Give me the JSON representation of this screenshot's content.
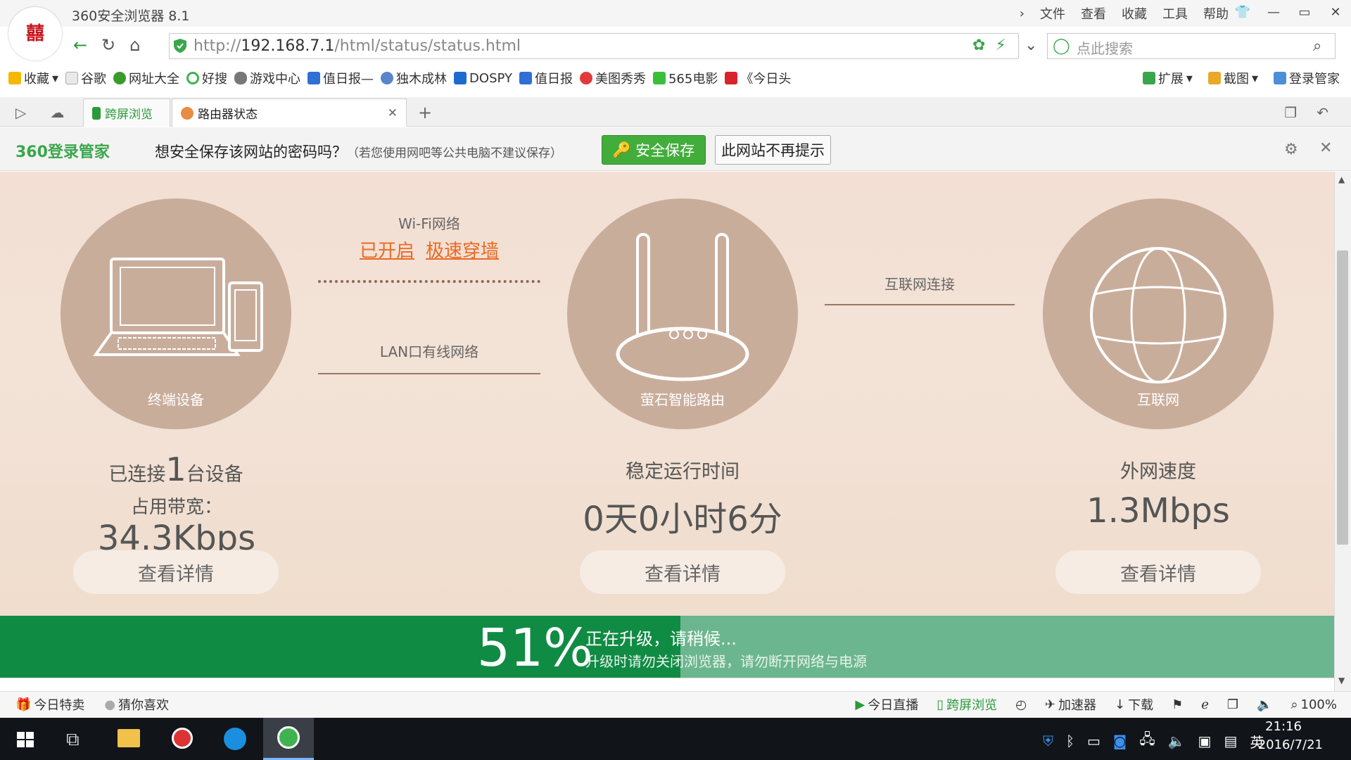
{
  "window": {
    "title": "360安全浏览器 8.1",
    "logo": "囍"
  },
  "menu": [
    "文件",
    "查看",
    "收藏",
    "工具",
    "帮助"
  ],
  "address": {
    "scheme": "http://",
    "host": "192.168.7.1",
    "path": "/html/status/status.html"
  },
  "search": {
    "placeholder": "点此搜索"
  },
  "bookmarks": [
    {
      "label": "收藏",
      "color": "#f5b800"
    },
    {
      "label": "谷歌",
      "color": "#bbb"
    },
    {
      "label": "网址大全",
      "color": "#3a9a2a"
    },
    {
      "label": "好搜",
      "color": "#3fb34f"
    },
    {
      "label": "游戏中心",
      "color": "#777"
    },
    {
      "label": "值日报—",
      "color": "#2f6fd6"
    },
    {
      "label": "独木成林",
      "color": "#5a86c9"
    },
    {
      "label": "DOSPY",
      "color": "#1f6ad0"
    },
    {
      "label": "值日报",
      "color": "#2f6fd6"
    },
    {
      "label": "美图秀秀",
      "color": "#e23a3a"
    },
    {
      "label": "565电影",
      "color": "#3bbf3b"
    },
    {
      "label": "《今日头",
      "color": "#d8232a"
    }
  ],
  "bookmarks_right": [
    "扩展",
    "截图",
    "登录管家"
  ],
  "tabs": [
    {
      "label": "跨屏浏览"
    },
    {
      "label": "路由器状态"
    }
  ],
  "password_bar": {
    "brand": "360登录管家",
    "message": "想安全保存该网站的密码吗？",
    "hint": "（若您使用网吧等公共电脑不建议保存）",
    "save": "安全保存",
    "never": "此网站不再提示"
  },
  "router": {
    "devices": {
      "circle_label": "终端设备",
      "connected_prefix": "已连接",
      "count": "1",
      "connected_suffix": "台设备",
      "bandwidth_label": "占用带宽：",
      "bandwidth": "34.3Kbps",
      "button": "查看详情"
    },
    "wifi": {
      "title": "Wi-Fi网络",
      "status": "已开启",
      "mode": "极速穿墙"
    },
    "lan": {
      "title": "LAN口有线网络"
    },
    "router": {
      "circle_label": "萤石智能路由",
      "uptime_label": "稳定运行时间",
      "uptime": "0天0小时6分",
      "button": "查看详情"
    },
    "internet_link": {
      "title": "互联网连接"
    },
    "internet": {
      "circle_label": "互联网",
      "speed_label": "外网速度",
      "speed": "1.3Mbps",
      "button": "查看详情"
    }
  },
  "upgrade": {
    "percent": "51%",
    "progress": 0.51,
    "title": "正在升级，请稍候...",
    "note": "升级时请勿关闭浏览器，请勿断开网络与电源"
  },
  "statusbar": {
    "left": [
      "今日特卖",
      "猜你喜欢"
    ],
    "right": [
      "今日直播",
      "跨屏浏览",
      "加速器",
      "下载"
    ],
    "zoom": "100%"
  },
  "taskbar": {
    "ime": "英",
    "time": "21:16",
    "date": "2016/7/21"
  }
}
